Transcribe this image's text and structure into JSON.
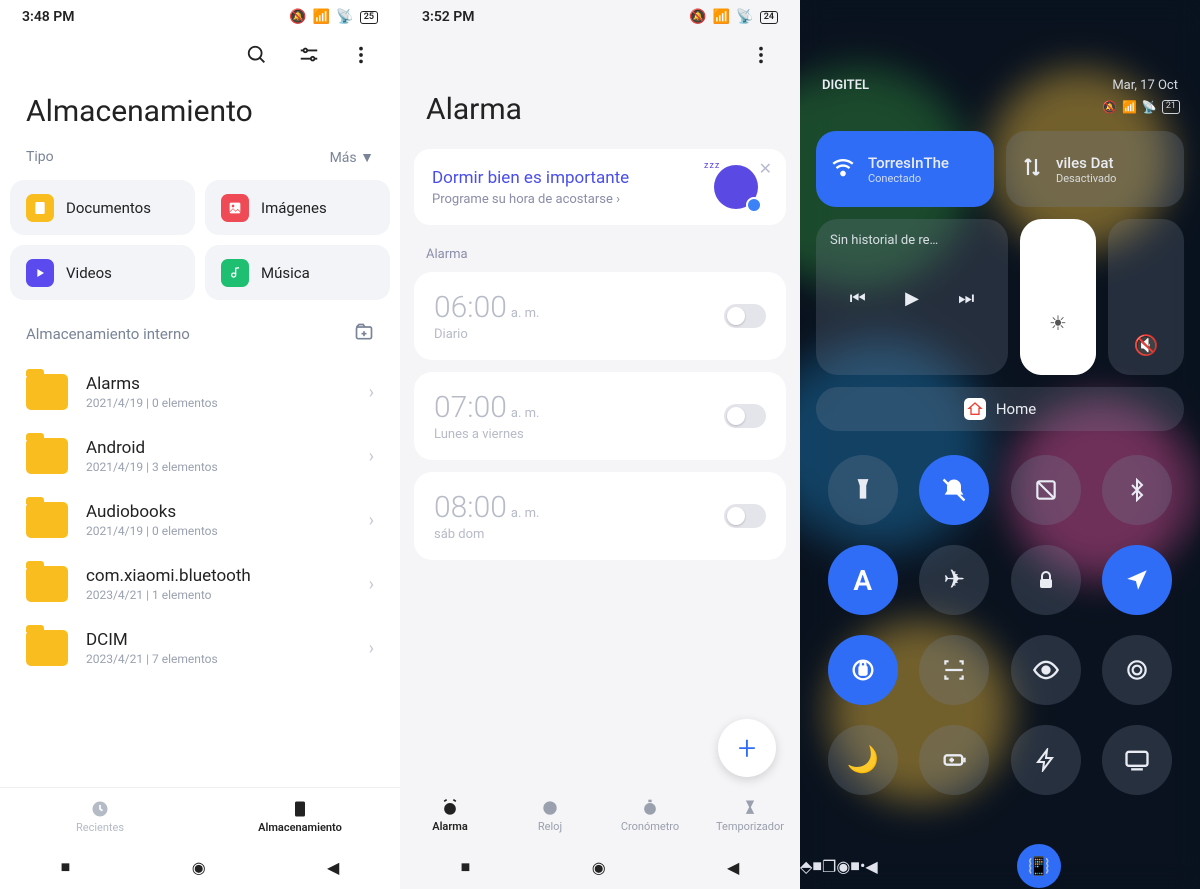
{
  "phone1": {
    "status": {
      "time": "3:48 PM",
      "battery": "25"
    },
    "title": "Almacenamiento",
    "tipo_label": "Tipo",
    "mas_label": "Más",
    "types": {
      "docs": "Documentos",
      "imgs": "Imágenes",
      "vids": "Videos",
      "music": "Música"
    },
    "internal_label": "Almacenamiento interno",
    "folders": [
      {
        "name": "Alarms",
        "meta": "2021/4/19  |  0 elementos"
      },
      {
        "name": "Android",
        "meta": "2021/4/19  |  3 elementos"
      },
      {
        "name": "Audiobooks",
        "meta": "2021/4/19  |  0 elementos"
      },
      {
        "name": "com.xiaomi.bluetooth",
        "meta": "2023/4/21  |  1 elemento"
      },
      {
        "name": "DCIM",
        "meta": "2023/4/21  |  7 elementos"
      }
    ],
    "nav": {
      "recent": "Recientes",
      "storage": "Almacenamiento"
    }
  },
  "phone2": {
    "status": {
      "time": "3:52 PM",
      "battery": "24"
    },
    "title": "Alarma",
    "sleep": {
      "title": "Dormir bien es importante",
      "sub": "Programe su hora de acostarse"
    },
    "section": "Alarma",
    "alarms": [
      {
        "time": "06:00",
        "ampm": "a. m.",
        "repeat": "Diario"
      },
      {
        "time": "07:00",
        "ampm": "a. m.",
        "repeat": "Lunes a viernes"
      },
      {
        "time": "08:00",
        "ampm": "a. m.",
        "repeat": "sáb dom"
      }
    ],
    "nav": {
      "alarm": "Alarma",
      "clock": "Reloj",
      "chrono": "Cronómetro",
      "timer": "Temporizador"
    }
  },
  "phone3": {
    "date": "Mar, 17 Oct",
    "carrier": "DIGITEL",
    "battery": "21",
    "wifi": {
      "name": "TorresInThe",
      "status": "Conectado"
    },
    "data": {
      "name": "viles    Dat",
      "status": "Desactivado"
    },
    "media_hist": "Sin historial de re…",
    "home": "Home"
  }
}
